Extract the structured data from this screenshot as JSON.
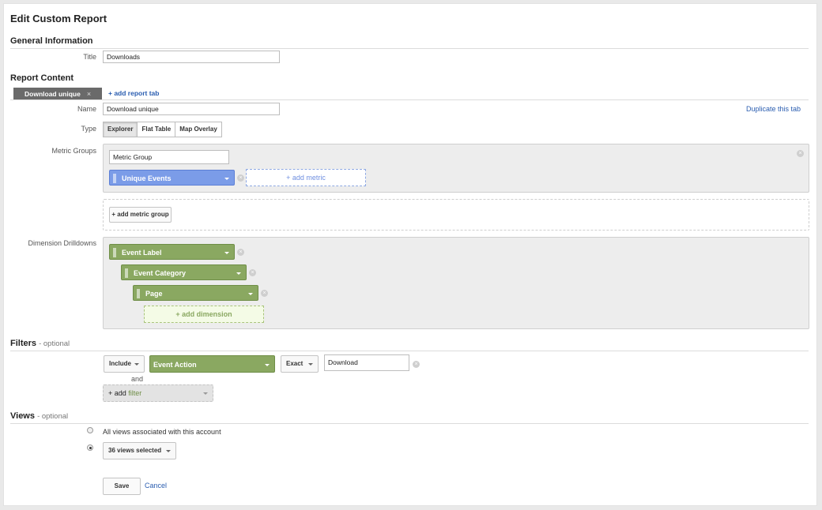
{
  "page": {
    "title": "Edit Custom Report"
  },
  "general": {
    "heading": "General Information",
    "title_label": "Title",
    "title_value": "Downloads"
  },
  "content": {
    "heading": "Report Content",
    "tabs": [
      {
        "label": "Download unique",
        "close": "×"
      }
    ],
    "add_tab_label": "+ add report tab",
    "name_label": "Name",
    "name_value": "Download unique",
    "duplicate_label": "Duplicate this tab",
    "type_label": "Type",
    "type_options": [
      "Explorer",
      "Flat Table",
      "Map Overlay"
    ],
    "type_selected": "Explorer",
    "metric_groups_label": "Metric Groups",
    "metric_group_name": "Metric Group",
    "metrics": [
      "Unique Events"
    ],
    "add_metric_label": "+ add metric",
    "add_metric_group_label": "+ add metric group",
    "drilldowns_label": "Dimension Drilldowns",
    "dimensions": [
      "Event Label",
      "Event Category",
      "Page"
    ],
    "add_dimension_label": "+ add dimension"
  },
  "filters": {
    "heading": "Filters",
    "optional": "- optional",
    "rows": [
      {
        "include": "Include",
        "dimension": "Event Action",
        "match": "Exact",
        "value": "Download"
      }
    ],
    "and_label": "and",
    "add_filter_prefix": "+ add",
    "add_filter_word": "filter"
  },
  "views": {
    "heading": "Views",
    "optional": "- optional",
    "all_views_label": "All views associated with this account",
    "selected_label": "36 views selected",
    "selected_option": "selected"
  },
  "actions": {
    "save_label": "Save",
    "cancel_label": "Cancel"
  },
  "colors": {
    "metric_chip": "#7b9ce8",
    "dimension_chip": "#8aa861",
    "link": "#2a5db0",
    "tab_chip": "#6a6a6a"
  },
  "icons": {
    "remove": "remove-icon",
    "dropdown": "caret-down-icon",
    "drag": "drag-handle-icon"
  }
}
